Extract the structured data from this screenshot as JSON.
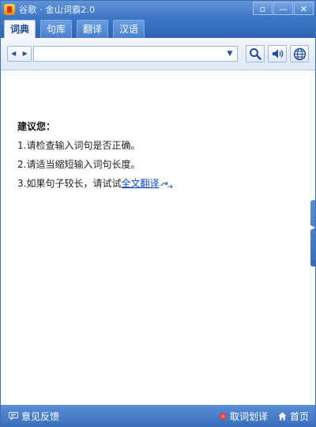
{
  "window": {
    "title": "谷歌 · 金山词霸2.0",
    "buttons": {
      "restore": "▫",
      "minimize": "—",
      "close": "✕"
    }
  },
  "tabs": [
    {
      "label": "词典",
      "active": true
    },
    {
      "label": "句库",
      "active": false
    },
    {
      "label": "翻译",
      "active": false
    },
    {
      "label": "汉语",
      "active": false
    }
  ],
  "toolbar": {
    "back_icon": "◀",
    "forward_icon": "▶",
    "search_value": "",
    "search_placeholder": "",
    "dropdown_icon": "▼"
  },
  "content": {
    "suggest_title": "建议您：",
    "lines": [
      "1.请检查输入词句是否正确。",
      "2.请适当缩短输入词句长度。",
      "3.如果句子较长，请试试"
    ],
    "full_translate_link": "全文翻译"
  },
  "status": {
    "feedback": "意见反馈",
    "pick_word": "取词划译",
    "home": "首页"
  },
  "colors": {
    "titlebar": "#4a80cc",
    "link": "#1148c8",
    "status_dot": "#d10000"
  }
}
